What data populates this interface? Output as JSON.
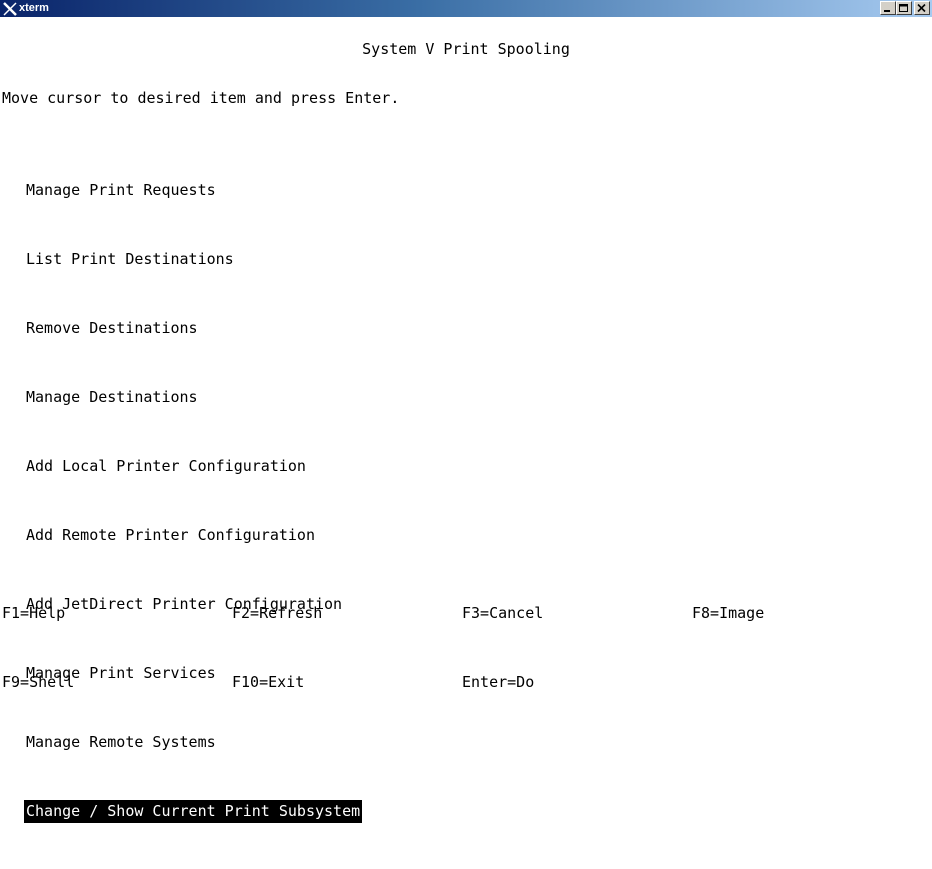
{
  "window": {
    "title": "xterm"
  },
  "screen": {
    "title": "System V Print Spooling",
    "instruction": "Move cursor to desired item and press Enter."
  },
  "menu": {
    "items": [
      {
        "label": "Manage Print Requests",
        "selected": false
      },
      {
        "label": "List Print Destinations",
        "selected": false
      },
      {
        "label": "Remove Destinations",
        "selected": false
      },
      {
        "label": "Manage Destinations",
        "selected": false
      },
      {
        "label": "Add Local Printer Configuration",
        "selected": false
      },
      {
        "label": "Add Remote Printer Configuration",
        "selected": false
      },
      {
        "label": "Add JetDirect Printer Configuration",
        "selected": false
      },
      {
        "label": "Manage Print Services",
        "selected": false
      },
      {
        "label": "Manage Remote Systems",
        "selected": false
      },
      {
        "label": "Change / Show Current Print Subsystem",
        "selected": true
      }
    ]
  },
  "function_keys": {
    "row1": [
      "F1=Help",
      "F2=Refresh",
      "F3=Cancel",
      "F8=Image"
    ],
    "row2": [
      "F9=Shell",
      "F10=Exit",
      "Enter=Do"
    ]
  },
  "colors": {
    "background": "#ffffff",
    "foreground": "#000000",
    "selection_bg": "#000000",
    "selection_fg": "#ffffff",
    "titlebar_start": "#0a246a",
    "titlebar_end": "#a6caf0"
  },
  "icons": {
    "app": "xterm-x-logo-icon",
    "minimize": "minimize-icon",
    "maximize": "maximize-icon",
    "close": "close-icon"
  }
}
